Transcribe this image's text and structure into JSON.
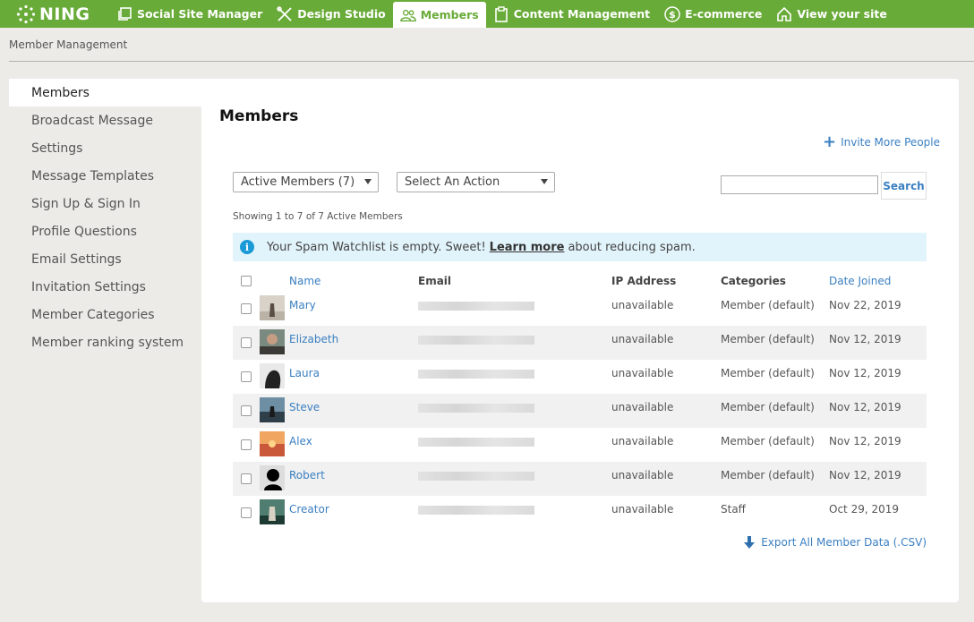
{
  "nav": {
    "logo": "NING",
    "items": [
      {
        "label": "Social Site Manager",
        "icon": "copy-icon"
      },
      {
        "label": "Design Studio",
        "icon": "tools-icon"
      },
      {
        "label": "Members",
        "icon": "users-icon",
        "active": true
      },
      {
        "label": "Content Management",
        "icon": "clipboard-icon"
      },
      {
        "label": "E-commerce",
        "icon": "dollar-icon"
      },
      {
        "label": "View your site",
        "icon": "home-icon"
      }
    ],
    "colors": {
      "bar": "#69ab38",
      "active_text": "#69ab38"
    }
  },
  "breadcrumb": "Member Management",
  "sidebar": {
    "items": [
      {
        "label": "Members",
        "active": true
      },
      {
        "label": "Broadcast Message"
      },
      {
        "label": "Settings"
      },
      {
        "label": "Message Templates"
      },
      {
        "label": "Sign Up & Sign In"
      },
      {
        "label": "Profile Questions"
      },
      {
        "label": "Email Settings"
      },
      {
        "label": "Invitation Settings"
      },
      {
        "label": "Member Categories"
      },
      {
        "label": "Member ranking system"
      }
    ]
  },
  "main": {
    "title": "Members",
    "invite_label": "Invite More People",
    "filter_select": "Active Members (7)",
    "action_select": "Select An Action",
    "search_value": "",
    "search_button": "Search",
    "showing": "Showing 1 to 7 of 7 Active Members",
    "notice": {
      "before": "Your Spam Watchlist is empty. Sweet!",
      "link": "Learn more",
      "after": "about reducing spam."
    },
    "columns": {
      "name": "Name",
      "email": "Email",
      "ip": "IP Address",
      "categories": "Categories",
      "date": "Date Joined"
    },
    "rows": [
      {
        "name": "Mary",
        "ip": "unavailable",
        "category": "Member (default)",
        "date": "Nov 22, 2019"
      },
      {
        "name": "Elizabeth",
        "ip": "unavailable",
        "category": "Member (default)",
        "date": "Nov 12, 2019"
      },
      {
        "name": "Laura",
        "ip": "unavailable",
        "category": "Member (default)",
        "date": "Nov 12, 2019"
      },
      {
        "name": "Steve",
        "ip": "unavailable",
        "category": "Member (default)",
        "date": "Nov 12, 2019"
      },
      {
        "name": "Alex",
        "ip": "unavailable",
        "category": "Member (default)",
        "date": "Nov 12, 2019"
      },
      {
        "name": "Robert",
        "ip": "unavailable",
        "category": "Member (default)",
        "date": "Nov 12, 2019"
      },
      {
        "name": "Creator",
        "ip": "unavailable",
        "category": "Staff",
        "date": "Oct 29, 2019"
      }
    ],
    "export_label": "Export All Member Data (.CSV)",
    "link_color": "#3a7fc1"
  }
}
